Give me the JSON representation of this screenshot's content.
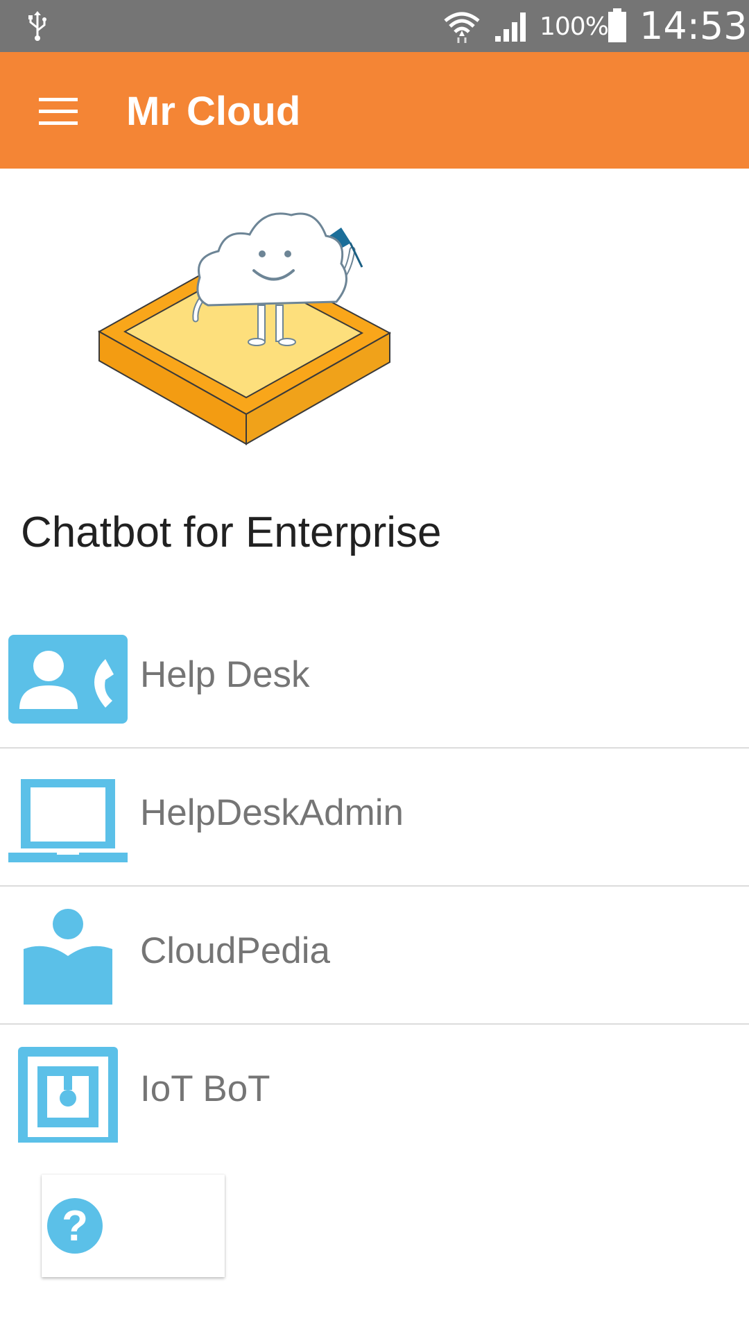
{
  "status_bar": {
    "battery_percent": "100%",
    "time": "14:53",
    "icons": [
      "usb-icon",
      "wifi-icon",
      "signal-icon",
      "battery-icon"
    ]
  },
  "app_bar": {
    "title": "Mr Cloud",
    "menu_icon": "hamburger-menu-icon"
  },
  "hero": {
    "image": "cloud-mascot-on-platform"
  },
  "heading": "Chatbot for Enterprise",
  "bots": [
    {
      "label": "Help Desk",
      "icon": "contact-phone-icon"
    },
    {
      "label": "HelpDeskAdmin",
      "icon": "laptop-icon"
    },
    {
      "label": "CloudPedia",
      "icon": "reader-book-icon"
    },
    {
      "label": "IoT BoT",
      "icon": "iot-chip-icon"
    }
  ],
  "help": {
    "icon": "help-icon",
    "glyph": "?"
  },
  "colors": {
    "accent": "#f48535",
    "icon_blue": "#5bc0e8",
    "status_bar": "#757575"
  }
}
